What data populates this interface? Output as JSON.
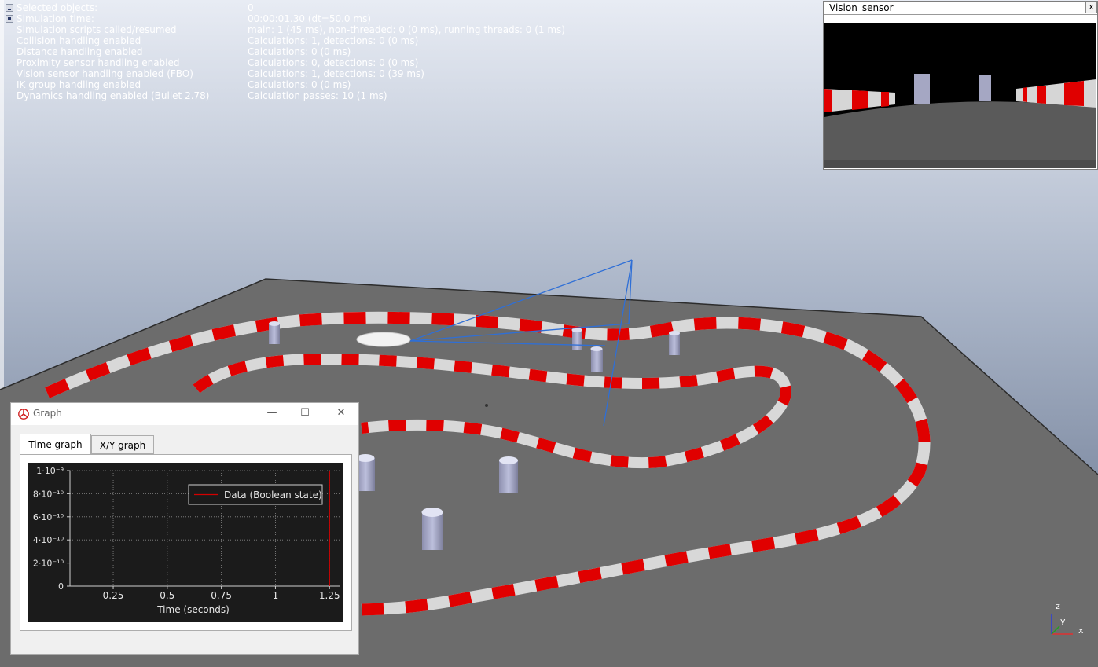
{
  "info_panel": {
    "rows": [
      {
        "label": "Selected objects:",
        "value": "0"
      },
      {
        "label": "Simulation time:",
        "value": "00:00:01.30 (dt=50.0 ms)"
      },
      {
        "label": "Simulation scripts called/resumed",
        "value": "main: 1 (45 ms), non-threaded: 0 (0 ms), running threads: 0 (1 ms)"
      },
      {
        "label": "Collision handling enabled",
        "value": "Calculations: 1, detections: 0 (0 ms)"
      },
      {
        "label": "Distance handling enabled",
        "value": "Calculations: 0 (0 ms)"
      },
      {
        "label": "Proximity sensor handling enabled",
        "value": "Calculations: 0, detections: 0 (0 ms)"
      },
      {
        "label": "Vision sensor handling enabled (FBO)",
        "value": "Calculations: 1, detections: 0 (39 ms)"
      },
      {
        "label": "IK group handling enabled",
        "value": "Calculations: 0 (0 ms)"
      },
      {
        "label": "Dynamics handling enabled (Bullet 2.78)",
        "value": "Calculation passes: 10 (1 ms)"
      }
    ]
  },
  "vision_sensor": {
    "title": "Vision_sensor",
    "close_label": "x"
  },
  "graph_window": {
    "title": "Graph",
    "minimize": "—",
    "maximize": "☐",
    "close": "✕",
    "tabs": [
      {
        "label": "Time graph",
        "active": true
      },
      {
        "label": "X/Y graph",
        "active": false
      }
    ]
  },
  "axis_gizmo": {
    "z": "z",
    "y": "y",
    "x": "x"
  },
  "colors": {
    "kerb_red": "#e00000",
    "kerb_white": "#d8d8d8",
    "floor": "#6a6a6a",
    "sensor_lines": "#2f6fd6",
    "plot_line": "#d40000"
  },
  "chart_data": {
    "type": "line",
    "xlabel": "Time (seconds)",
    "x_ticks": [
      "0.25",
      "0.5",
      "0.75",
      "1",
      "1.25"
    ],
    "y_ticks": [
      "0",
      "2·10⁻¹⁰",
      "4·10⁻¹⁰",
      "6·10⁻¹⁰",
      "8·10⁻¹⁰",
      "1·10⁻⁹"
    ],
    "xlim": [
      0.05,
      1.3
    ],
    "ylim": [
      0,
      1e-09
    ],
    "grid": true,
    "legend_position": "top-right",
    "series": [
      {
        "name": "Data (Boolean state)",
        "x": [
          1.25,
          1.25
        ],
        "y": [
          0,
          1e-09
        ]
      }
    ]
  }
}
